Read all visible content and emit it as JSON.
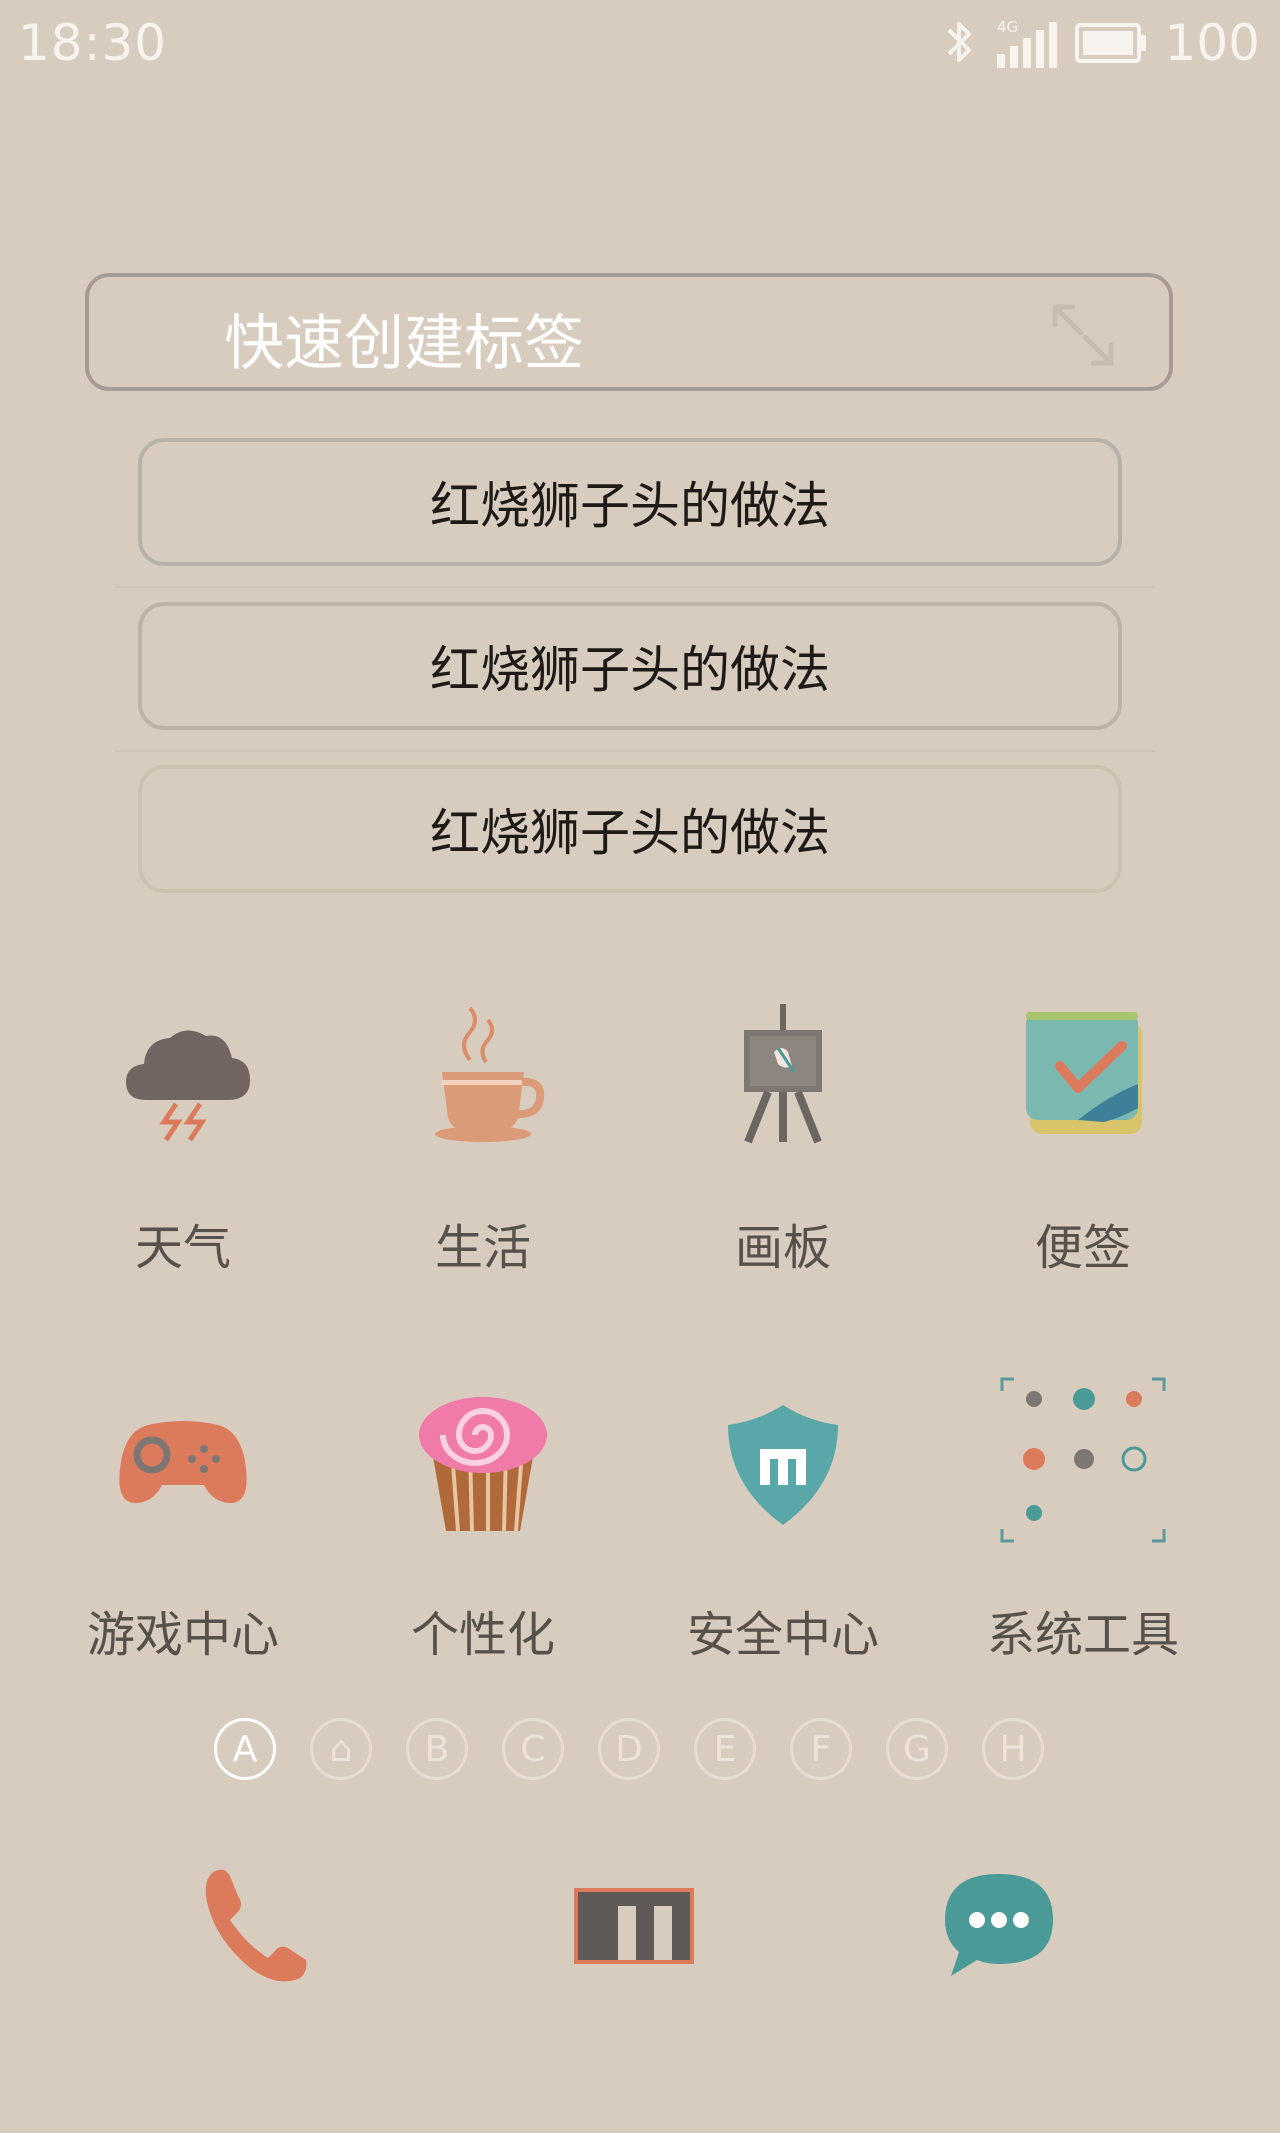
{
  "status_bar": {
    "time": "18:30",
    "network_label": "4G",
    "battery": "100",
    "icons": [
      "bluetooth-icon",
      "signal-icon",
      "battery-icon"
    ]
  },
  "widget": {
    "title": "快速创建标签",
    "expand_icon": "expand-icon",
    "notes": [
      {
        "label": "红烧狮子头的做法"
      },
      {
        "label": "红烧狮子头的做法"
      },
      {
        "label": "红烧狮子头的做法"
      }
    ]
  },
  "apps": [
    {
      "label": "天气",
      "icon": "weather-icon"
    },
    {
      "label": "生活",
      "icon": "coffee-icon"
    },
    {
      "label": "画板",
      "icon": "easel-icon"
    },
    {
      "label": "便签",
      "icon": "notes-icon"
    },
    {
      "label": "游戏中心",
      "icon": "gamepad-icon"
    },
    {
      "label": "个性化",
      "icon": "cupcake-icon"
    },
    {
      "label": "安全中心",
      "icon": "shield-icon"
    },
    {
      "label": "系统工具",
      "icon": "tools-folder-icon"
    }
  ],
  "page_indicator": {
    "items": [
      "A",
      "⌂",
      "B",
      "C",
      "D",
      "E",
      "F",
      "G",
      "H"
    ],
    "active": "A"
  },
  "dock": [
    {
      "icon": "phone-icon"
    },
    {
      "icon": "browser-icon"
    },
    {
      "icon": "messages-icon"
    }
  ],
  "colors": {
    "background": "#d8ccbf",
    "accent_orange": "#db7b5c",
    "accent_teal": "#4a9a98",
    "text_dark": "#57514c"
  }
}
